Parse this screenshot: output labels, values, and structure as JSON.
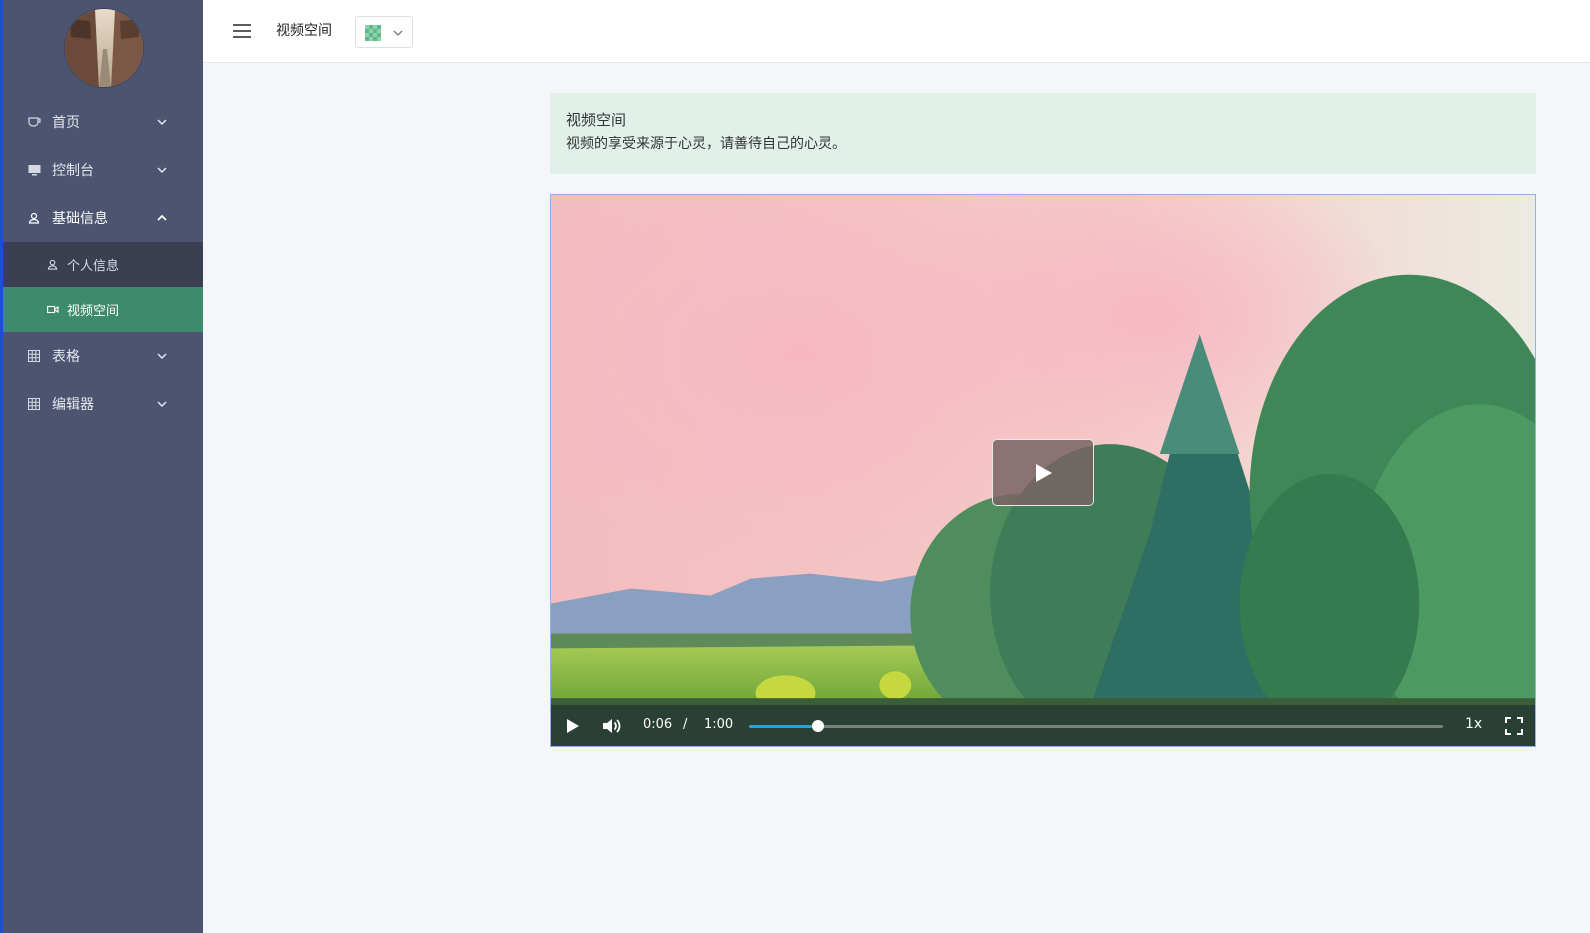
{
  "sidebar": {
    "items": [
      {
        "label": "首页",
        "icon": "cup-icon"
      },
      {
        "label": "控制台",
        "icon": "monitor-icon"
      },
      {
        "label": "基础信息",
        "icon": "user-icon",
        "expanded": true,
        "children": [
          {
            "label": "个人信息",
            "icon": "user-icon"
          },
          {
            "label": "视频空间",
            "icon": "video-camera-icon",
            "active": true
          }
        ]
      },
      {
        "label": "表格",
        "icon": "grid-icon"
      },
      {
        "label": "编辑器",
        "icon": "grid-icon"
      }
    ]
  },
  "header": {
    "breadcrumb": "视频空间"
  },
  "notice": {
    "title": "视频空间",
    "text": "视频的享受来源于心灵，请善待自己的心灵。"
  },
  "player": {
    "current_time": "0:06",
    "separator": "/",
    "duration": "1:00",
    "progress": 0.1,
    "rate": "1x"
  },
  "colors": {
    "sidebar_bg": "#4d5470",
    "submenu_bg": "#3a3f52",
    "active_item": "#3d8a6d",
    "notice_bg": "#e2f0ea",
    "progress": "#22a7d8"
  }
}
